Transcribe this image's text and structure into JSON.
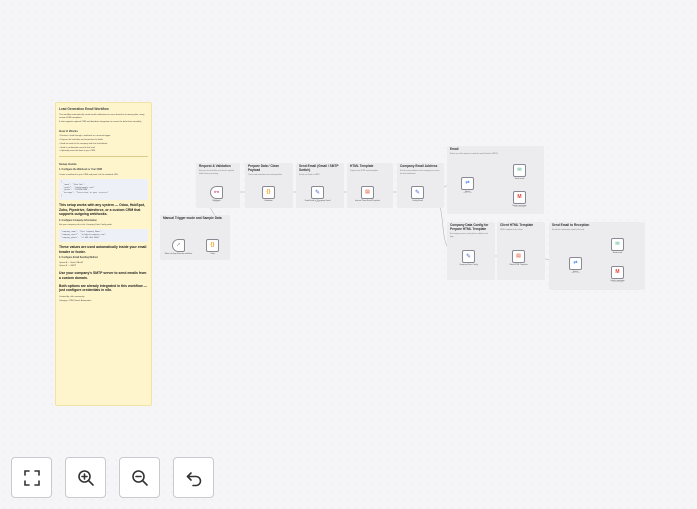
{
  "note": {
    "title": "Lead Generation Email Workflow",
    "intro": [
      "This workflow automatically sends email notifications to users based on incoming data, using custom HTML templates.",
      "It also supports optional CRM and database integration to ensure the data flows smoothly."
    ],
    "how_title": "How It Works",
    "how_lines": [
      "Receive a lead through a webhook or a manual trigger.",
      "Prepare the lead data and normalize the fields.",
      "Send an email to the company with the lead details.",
      "Send a confirmation email to the lead.",
      "Optionally store the data in your CRM."
    ],
    "setup_title": "Setup Guide",
    "step1": "1. Configure the Webhook or Your CRM",
    "step1_text": "Create a webhook in your CRM and point it to the webhook URL.",
    "code1": "{\n  \"name\": \"John Doe\",\n  \"email\": \"john@example.com\",\n  \"phone\": \"+1234567890\",\n  \"message\": \"Interested in your services\"\n}",
    "crm_text": "This setup works with any system — Odoo, HubSpot, Zoho, Pipedrive, Salesforce, or a custom CRM that supports outgoing webhooks.",
    "step2": "2. Configure Company Information",
    "step2_text": "Set your company info in the Company Data Config node.",
    "code2": "\"company_name\": \"Your Company Name\",\n\"company_email\": \"info@yourcompany.com\",\n\"company_phone\": \"+1 000 000 0000\"",
    "values_text": "These values are used automatically inside your email header or footer.",
    "step3": "3. Configure Email Sending Method",
    "step3_lines": [
      "Option A — Gmail OAuth2",
      "Option B — SMTP"
    ],
    "smtp_text": "Use your company's SMTP server to send emails from a custom domain.",
    "both_text": "Both options are already integrated in this workflow — just configure credentials in n8n.",
    "footer": [
      "Created by: n8n community",
      "Category: CRM, Email, Automation"
    ]
  },
  "groups": {
    "validation": {
      "title": "Request & Validation",
      "text": "Receives the lead data and checks required fields before processing."
    },
    "prepare": {
      "title": "Prepare Data / Clean Payload",
      "text": "Cleans and normalizes the incoming fields."
    },
    "send_gmail": {
      "title": "Send Email (Gmail / SMTP Switch)",
      "text": "Sends via Gmail or SMTP."
    },
    "html_template": {
      "title": "HTML Template",
      "text": "Prepares the HTML email template."
    },
    "company_email": {
      "title": "Company Email Address",
      "text": "Sets the email address of the company to receive the lead notification."
    },
    "email": {
      "title": "Email",
      "text": "Select one of the options to send the email (Gmail or SMTP)."
    },
    "manual": {
      "title": "Manual Trigger mode and Sample Data",
      "text": ""
    },
    "company_config": {
      "title": "Company Data Config for Prepare HTML Template",
      "text": "Set company name, email, phone, address and logo."
    },
    "client_template": {
      "title": "Client HTML Template",
      "text": "HTML template for the client."
    },
    "send_reception": {
      "title": "Send Email to Reception",
      "text": "Sends the confirmation email to the lead."
    }
  },
  "nodes": {
    "webhook": {
      "label": "Webhook",
      "sub": "POST"
    },
    "validate": {
      "label": "Validation",
      "sub": ""
    },
    "send_company": {
      "label": "Send Email to Company Gmail",
      "sub": "send"
    },
    "company_template": {
      "label": "Internal Team Email Template",
      "sub": ""
    },
    "config_email": {
      "label": "Config Email",
      "sub": ""
    },
    "switch1": {
      "label": "Switch",
      "sub": "mode: rules"
    },
    "smtp1": {
      "label": "Send email",
      "sub": ""
    },
    "gmail1": {
      "label": "Send a message",
      "sub": "send: message"
    },
    "manual_trigger": {
      "label": "When clicking 'Execute workflow'",
      "sub": ""
    },
    "sample_data": {
      "label": "Code",
      "sub": ""
    },
    "company_data": {
      "label": "Company Data Config",
      "sub": ""
    },
    "client_template": {
      "label": "Client HTML Template",
      "sub": ""
    },
    "switch2": {
      "label": "Switch",
      "sub": "mode: rules"
    },
    "smtp2": {
      "label": "Send email",
      "sub": ""
    },
    "gmail2": {
      "label": "Send a message",
      "sub": "send: message"
    }
  },
  "icons": {
    "webhook": "webhook-icon",
    "code": "code-icon",
    "edit": "edit-fields-icon",
    "html": "html-file-icon",
    "switch": "switch-icon",
    "mail": "email-icon",
    "gmail": "gmail-icon",
    "cursor": "cursor-click-icon"
  },
  "colors": {
    "webhook": "#c63b6d",
    "code": "#f39c12",
    "edit": "#4b60d6",
    "html": "#e44d26",
    "switch": "#3b82f6",
    "mail": "#2aa876",
    "gmail": "#ea4335",
    "note_bg": "#fff5cc"
  },
  "controls": {
    "fit": "Fit view",
    "zoom_in": "Zoom in",
    "zoom_out": "Zoom out",
    "reset": "Reset zoom"
  }
}
